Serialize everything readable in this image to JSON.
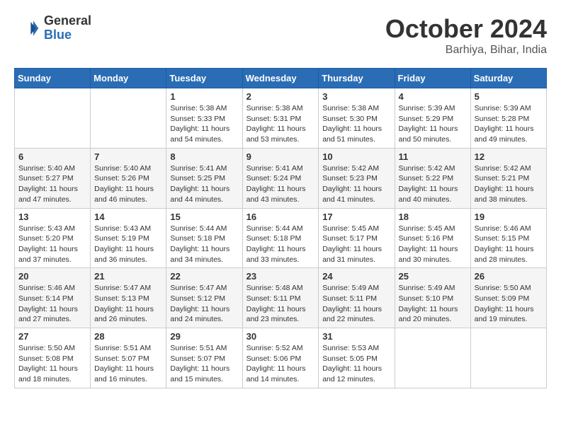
{
  "header": {
    "logo_general": "General",
    "logo_blue": "Blue",
    "month_title": "October 2024",
    "location": "Barhiya, Bihar, India"
  },
  "weekdays": [
    "Sunday",
    "Monday",
    "Tuesday",
    "Wednesday",
    "Thursday",
    "Friday",
    "Saturday"
  ],
  "weeks": [
    [
      {
        "day": "",
        "info": ""
      },
      {
        "day": "",
        "info": ""
      },
      {
        "day": "1",
        "info": "Sunrise: 5:38 AM\nSunset: 5:33 PM\nDaylight: 11 hours and 54 minutes."
      },
      {
        "day": "2",
        "info": "Sunrise: 5:38 AM\nSunset: 5:31 PM\nDaylight: 11 hours and 53 minutes."
      },
      {
        "day": "3",
        "info": "Sunrise: 5:38 AM\nSunset: 5:30 PM\nDaylight: 11 hours and 51 minutes."
      },
      {
        "day": "4",
        "info": "Sunrise: 5:39 AM\nSunset: 5:29 PM\nDaylight: 11 hours and 50 minutes."
      },
      {
        "day": "5",
        "info": "Sunrise: 5:39 AM\nSunset: 5:28 PM\nDaylight: 11 hours and 49 minutes."
      }
    ],
    [
      {
        "day": "6",
        "info": "Sunrise: 5:40 AM\nSunset: 5:27 PM\nDaylight: 11 hours and 47 minutes."
      },
      {
        "day": "7",
        "info": "Sunrise: 5:40 AM\nSunset: 5:26 PM\nDaylight: 11 hours and 46 minutes."
      },
      {
        "day": "8",
        "info": "Sunrise: 5:41 AM\nSunset: 5:25 PM\nDaylight: 11 hours and 44 minutes."
      },
      {
        "day": "9",
        "info": "Sunrise: 5:41 AM\nSunset: 5:24 PM\nDaylight: 11 hours and 43 minutes."
      },
      {
        "day": "10",
        "info": "Sunrise: 5:42 AM\nSunset: 5:23 PM\nDaylight: 11 hours and 41 minutes."
      },
      {
        "day": "11",
        "info": "Sunrise: 5:42 AM\nSunset: 5:22 PM\nDaylight: 11 hours and 40 minutes."
      },
      {
        "day": "12",
        "info": "Sunrise: 5:42 AM\nSunset: 5:21 PM\nDaylight: 11 hours and 38 minutes."
      }
    ],
    [
      {
        "day": "13",
        "info": "Sunrise: 5:43 AM\nSunset: 5:20 PM\nDaylight: 11 hours and 37 minutes."
      },
      {
        "day": "14",
        "info": "Sunrise: 5:43 AM\nSunset: 5:19 PM\nDaylight: 11 hours and 36 minutes."
      },
      {
        "day": "15",
        "info": "Sunrise: 5:44 AM\nSunset: 5:18 PM\nDaylight: 11 hours and 34 minutes."
      },
      {
        "day": "16",
        "info": "Sunrise: 5:44 AM\nSunset: 5:18 PM\nDaylight: 11 hours and 33 minutes."
      },
      {
        "day": "17",
        "info": "Sunrise: 5:45 AM\nSunset: 5:17 PM\nDaylight: 11 hours and 31 minutes."
      },
      {
        "day": "18",
        "info": "Sunrise: 5:45 AM\nSunset: 5:16 PM\nDaylight: 11 hours and 30 minutes."
      },
      {
        "day": "19",
        "info": "Sunrise: 5:46 AM\nSunset: 5:15 PM\nDaylight: 11 hours and 28 minutes."
      }
    ],
    [
      {
        "day": "20",
        "info": "Sunrise: 5:46 AM\nSunset: 5:14 PM\nDaylight: 11 hours and 27 minutes."
      },
      {
        "day": "21",
        "info": "Sunrise: 5:47 AM\nSunset: 5:13 PM\nDaylight: 11 hours and 26 minutes."
      },
      {
        "day": "22",
        "info": "Sunrise: 5:47 AM\nSunset: 5:12 PM\nDaylight: 11 hours and 24 minutes."
      },
      {
        "day": "23",
        "info": "Sunrise: 5:48 AM\nSunset: 5:11 PM\nDaylight: 11 hours and 23 minutes."
      },
      {
        "day": "24",
        "info": "Sunrise: 5:49 AM\nSunset: 5:11 PM\nDaylight: 11 hours and 22 minutes."
      },
      {
        "day": "25",
        "info": "Sunrise: 5:49 AM\nSunset: 5:10 PM\nDaylight: 11 hours and 20 minutes."
      },
      {
        "day": "26",
        "info": "Sunrise: 5:50 AM\nSunset: 5:09 PM\nDaylight: 11 hours and 19 minutes."
      }
    ],
    [
      {
        "day": "27",
        "info": "Sunrise: 5:50 AM\nSunset: 5:08 PM\nDaylight: 11 hours and 18 minutes."
      },
      {
        "day": "28",
        "info": "Sunrise: 5:51 AM\nSunset: 5:07 PM\nDaylight: 11 hours and 16 minutes."
      },
      {
        "day": "29",
        "info": "Sunrise: 5:51 AM\nSunset: 5:07 PM\nDaylight: 11 hours and 15 minutes."
      },
      {
        "day": "30",
        "info": "Sunrise: 5:52 AM\nSunset: 5:06 PM\nDaylight: 11 hours and 14 minutes."
      },
      {
        "day": "31",
        "info": "Sunrise: 5:53 AM\nSunset: 5:05 PM\nDaylight: 11 hours and 12 minutes."
      },
      {
        "day": "",
        "info": ""
      },
      {
        "day": "",
        "info": ""
      }
    ]
  ]
}
